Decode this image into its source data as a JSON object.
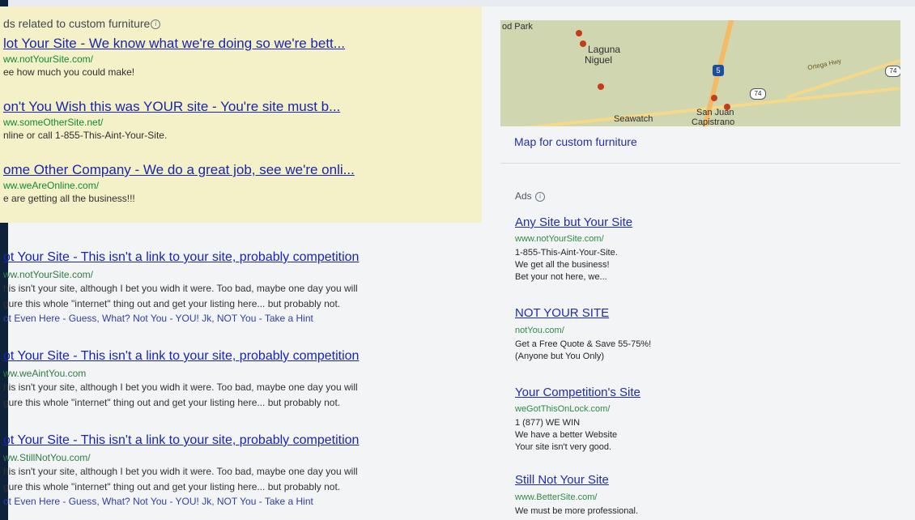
{
  "top_ads": {
    "label": "ds related to custom furniture",
    "items": [
      {
        "title": "lot Your Site - We know what we're doing so we're bett...",
        "url": "ww.notYourSite.com/",
        "text": "ee how much you could make!"
      },
      {
        "title": "on't You Wish this was YOUR site - You're site must b...",
        "url": "ww.someOtherSite.net/",
        "text": "nline or call 1-855-This-Aint-Your-Site."
      },
      {
        "title": "ome Other Company - We do a great job, see we're onli...",
        "url": "ww.weAreOnline.com/",
        "text": "e are getting all the business!!!"
      }
    ]
  },
  "organic_results": [
    {
      "title": "ot Your Site - This isn't a link to your site, probably competition",
      "url": "ww.notYourSite.com/",
      "desc_lines": [
        "his isn't your site, although I bet you widh it were. Too bad, maybe one day you will",
        "gure this whole \"internet\" thing out and get your listing here... but probably not."
      ],
      "links": "ot Even Here - Guess, What? Not You - YOU! Jk, NOT You - Take a Hint"
    },
    {
      "title": "ot Your Site - This isn't a link to your site, probably competition",
      "url": "ww.weAintYou.com",
      "desc_lines": [
        "his isn't your site, although I bet you widh it were. Too bad, maybe one day you will",
        "gure this whole \"internet\" thing out and get your listing here... but probably not."
      ],
      "links": ""
    },
    {
      "title": "ot Your Site - This isn't a link to your site, probably competition",
      "url": "ww.StillNotYou.com/",
      "desc_lines": [
        "his isn't your site, although I bet you widh it were. Too bad, maybe one day you will",
        "gure this whole \"internet\" thing out and get your listing here... but probably not."
      ],
      "links": "ot Even Here - Guess, What? Not You - YOU! Jk, NOT You - Take a Hint"
    }
  ],
  "map": {
    "labels": [
      "od Park",
      "Laguna",
      "Niguel",
      "Seawatch",
      "San Juan",
      "Capistrano",
      "Ortega Hwy"
    ],
    "shields": [
      "5",
      "74",
      "74"
    ],
    "caption": "Map for custom furniture"
  },
  "side_ads": {
    "label": "Ads",
    "items": [
      {
        "title": "Any Site but Your Site",
        "url": "www.notYourSite.com/",
        "text": "1-855-This-Aint-Your-Site.\nWe get all the business!\nBet your not here, we..."
      },
      {
        "title": "NOT YOUR SITE",
        "url": "notYou.com/",
        "text": "Get a Free Quote & Save 55-75%!\n(Anyone but You Only)"
      },
      {
        "title": "Your Competition's Site",
        "url": "weGotThisOnLock.com/",
        "text": "1 (877) WE WIN\nWe have a better Website\nYour site isn't very good."
      },
      {
        "title": "Still Not Your Site",
        "url": "www.BetterSite.com/",
        "text": "We must be more professional."
      }
    ]
  }
}
